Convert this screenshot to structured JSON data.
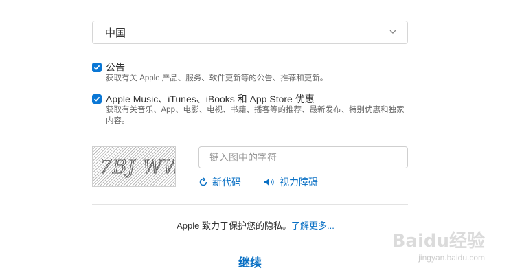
{
  "country": {
    "selected": "中国"
  },
  "options": [
    {
      "title": "公告",
      "description": "获取有关 Apple 产品、服务、软件更新等的公告、推荐和更新。",
      "checked": true
    },
    {
      "title": "Apple Music、iTunes、iBooks 和 App Store 优惠",
      "description": "获取有关音乐、App、电影、电视、书籍、播客等的推荐、最新发布、特别优惠和独家内容。",
      "checked": true
    }
  ],
  "captcha": {
    "image_text": "7BJ WW",
    "input_placeholder": "键入图中的字符",
    "new_code_label": "新代码",
    "vision_label": "视力障碍"
  },
  "privacy": {
    "text": "Apple 致力于保护您的隐私。",
    "link": "了解更多..."
  },
  "continue_label": "继续",
  "watermark": {
    "logo": "Baidu经验",
    "url": "jingyan.baidu.com"
  },
  "colors": {
    "accent": "#0a77d5",
    "link": "#0a70c4",
    "border": "#d6d6d6"
  }
}
